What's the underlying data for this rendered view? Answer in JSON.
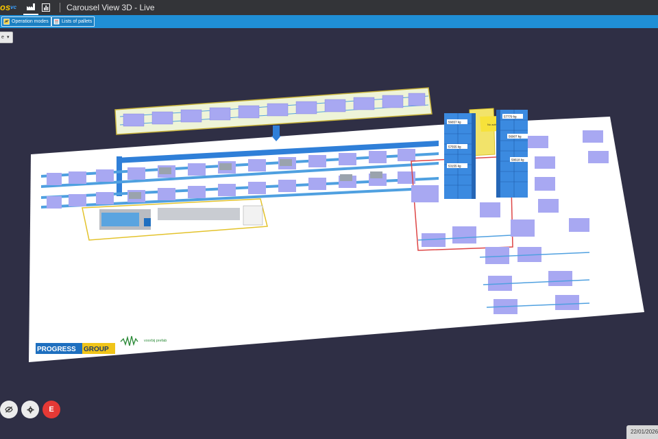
{
  "header": {
    "logo_text": "os",
    "logo_superscript": "vc",
    "title": "Carousel View 3D - Live"
  },
  "toolbar": {
    "operation_modes": "Operation modes",
    "lists_of_pallets": "Lists of pallets"
  },
  "view_selector": {
    "value": "e"
  },
  "plant": {
    "brand_left": "PROGRESS",
    "brand_right": "GROUP",
    "partner": "voorbij prefab",
    "tower_labels": [
      "53155 kg",
      "56657 kg",
      "57555 kg",
      "57779 kg",
      "56907 kg",
      "58618 kg"
    ],
    "banner": "No active layers"
  },
  "buttons": {
    "e_label": "E"
  },
  "status": {
    "date": "22/01/2026"
  },
  "colors": {
    "topbar": "#333438",
    "toolbar": "#1f8fd6",
    "background": "#2f2f45",
    "tower": "#2f7fd8",
    "pallet": "#9d9df0",
    "rail": "#e3c22a"
  }
}
